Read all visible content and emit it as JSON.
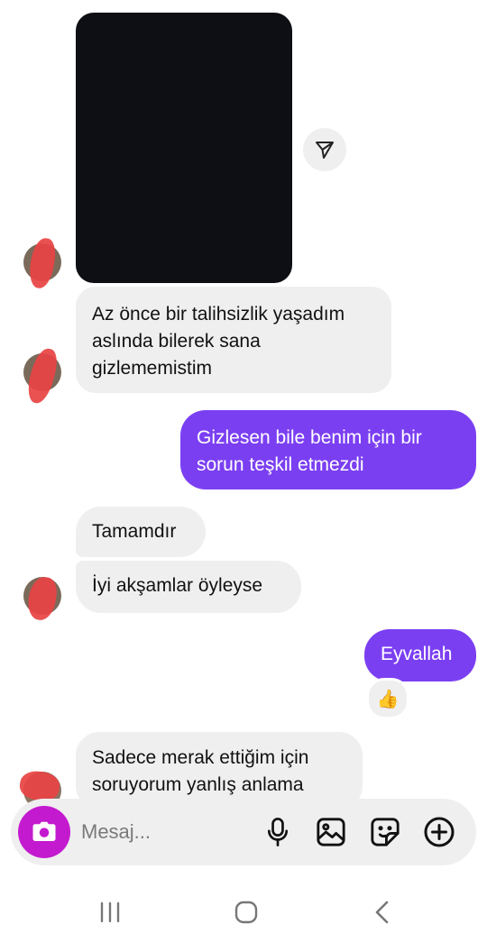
{
  "messages": {
    "m1": "Az önce bir talihsizlik yaşadım aslında bilerek sana gizlememistim",
    "m2": "Gizlesen bile benim için bir sorun teşkil etmezdi",
    "m3": "Tamamdır",
    "m4": "İyi akşamlar öyleyse",
    "m5": "Eyvallah",
    "m6": "Sadece merak ettiğim için soruyorum yanlış anlama"
  },
  "reaction": {
    "emoji": "👍"
  },
  "composer": {
    "placeholder": "Mesaj...",
    "icons": [
      "camera-icon",
      "microphone-icon",
      "gallery-icon",
      "sticker-icon",
      "plus-icon"
    ]
  },
  "navigation": {
    "buttons": [
      "recent-apps",
      "home",
      "back"
    ]
  },
  "colors": {
    "sent_bubble": "#7b3ff2",
    "received_bubble": "#efefef",
    "camera_button": "#c41acf",
    "media_placeholder": "#0d0f14"
  }
}
